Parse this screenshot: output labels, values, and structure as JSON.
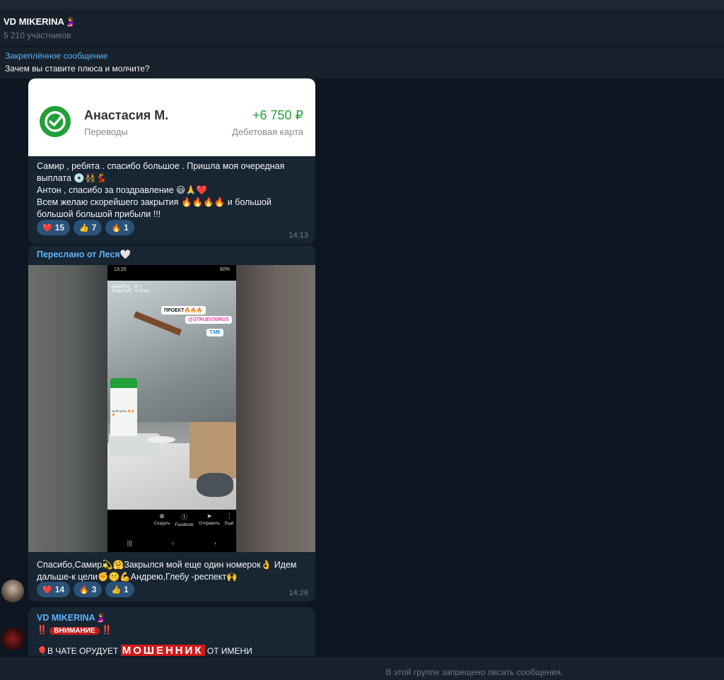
{
  "header": {
    "title": "VD MIKERINA🤰",
    "subtitle": "5 210 участников"
  },
  "pinned": {
    "label": "Закреплённое сообщение",
    "text": "Зачем вы ставите плюса и молчите?"
  },
  "messages": [
    {
      "card": {
        "name": "Анастасия М.",
        "category": "Переводы",
        "amount": "+6 750 ₽",
        "account_type": "Дебетовая карта"
      },
      "text": "Самир , ребята . спасибо большое . Пришла моя очередная выплата 💿👯‍♀️💃\nАнтон , спасибо за поздравление 😃🙏❤️\nВсем желаю скорейшего закрытия 🔥🔥🔥🔥 и большой большой большой прибыли !!!",
      "reactions": [
        {
          "emoji": "❤️",
          "count": "15"
        },
        {
          "emoji": "👍",
          "count": "7"
        },
        {
          "emoji": "🔥",
          "count": "1"
        }
      ],
      "time": "14:13"
    },
    {
      "forwarded_from": "Переслано от Леся🤍",
      "photo": {
        "status_time": "13:20",
        "status_right": "60%",
        "story_user": "lesia8032_ 16 ч",
        "story_music": "Stray Kids · S-Class",
        "chip1": "ПРОЕКТ🔥🔥🔥",
        "chip2": "@STRUEV30RUS",
        "chip3": "T.ME",
        "mini_text": "МОЙ ЦЕЛЬ 🔥🔥🔥",
        "actions": [
          "Создать",
          "Facebook",
          "Отправить",
          "Ещё"
        ]
      },
      "text": "Спасибо,Самир💫🤗Закрылся мой еще один номерок👌 Идем дальше-к цели✊🤫💪Андрею,Глебу -респект🙌",
      "reactions": [
        {
          "emoji": "❤️",
          "count": "14"
        },
        {
          "emoji": "🔥",
          "count": "3"
        },
        {
          "emoji": "👍",
          "count": "1"
        }
      ],
      "time": "14:26"
    },
    {
      "sender": "VD MIKERINA🤰",
      "warning_marks": "‼️",
      "warning_badge": "ВНИМАНИЕ",
      "line_start": "🎈В ЧАТЕ ОРУДУЕТ",
      "highlight": "МОШЕННИК",
      "line_end": "ОТ ИМЕНИ"
    }
  ],
  "footer": {
    "notice": "В этой группе запрещено писать сообщения."
  }
}
